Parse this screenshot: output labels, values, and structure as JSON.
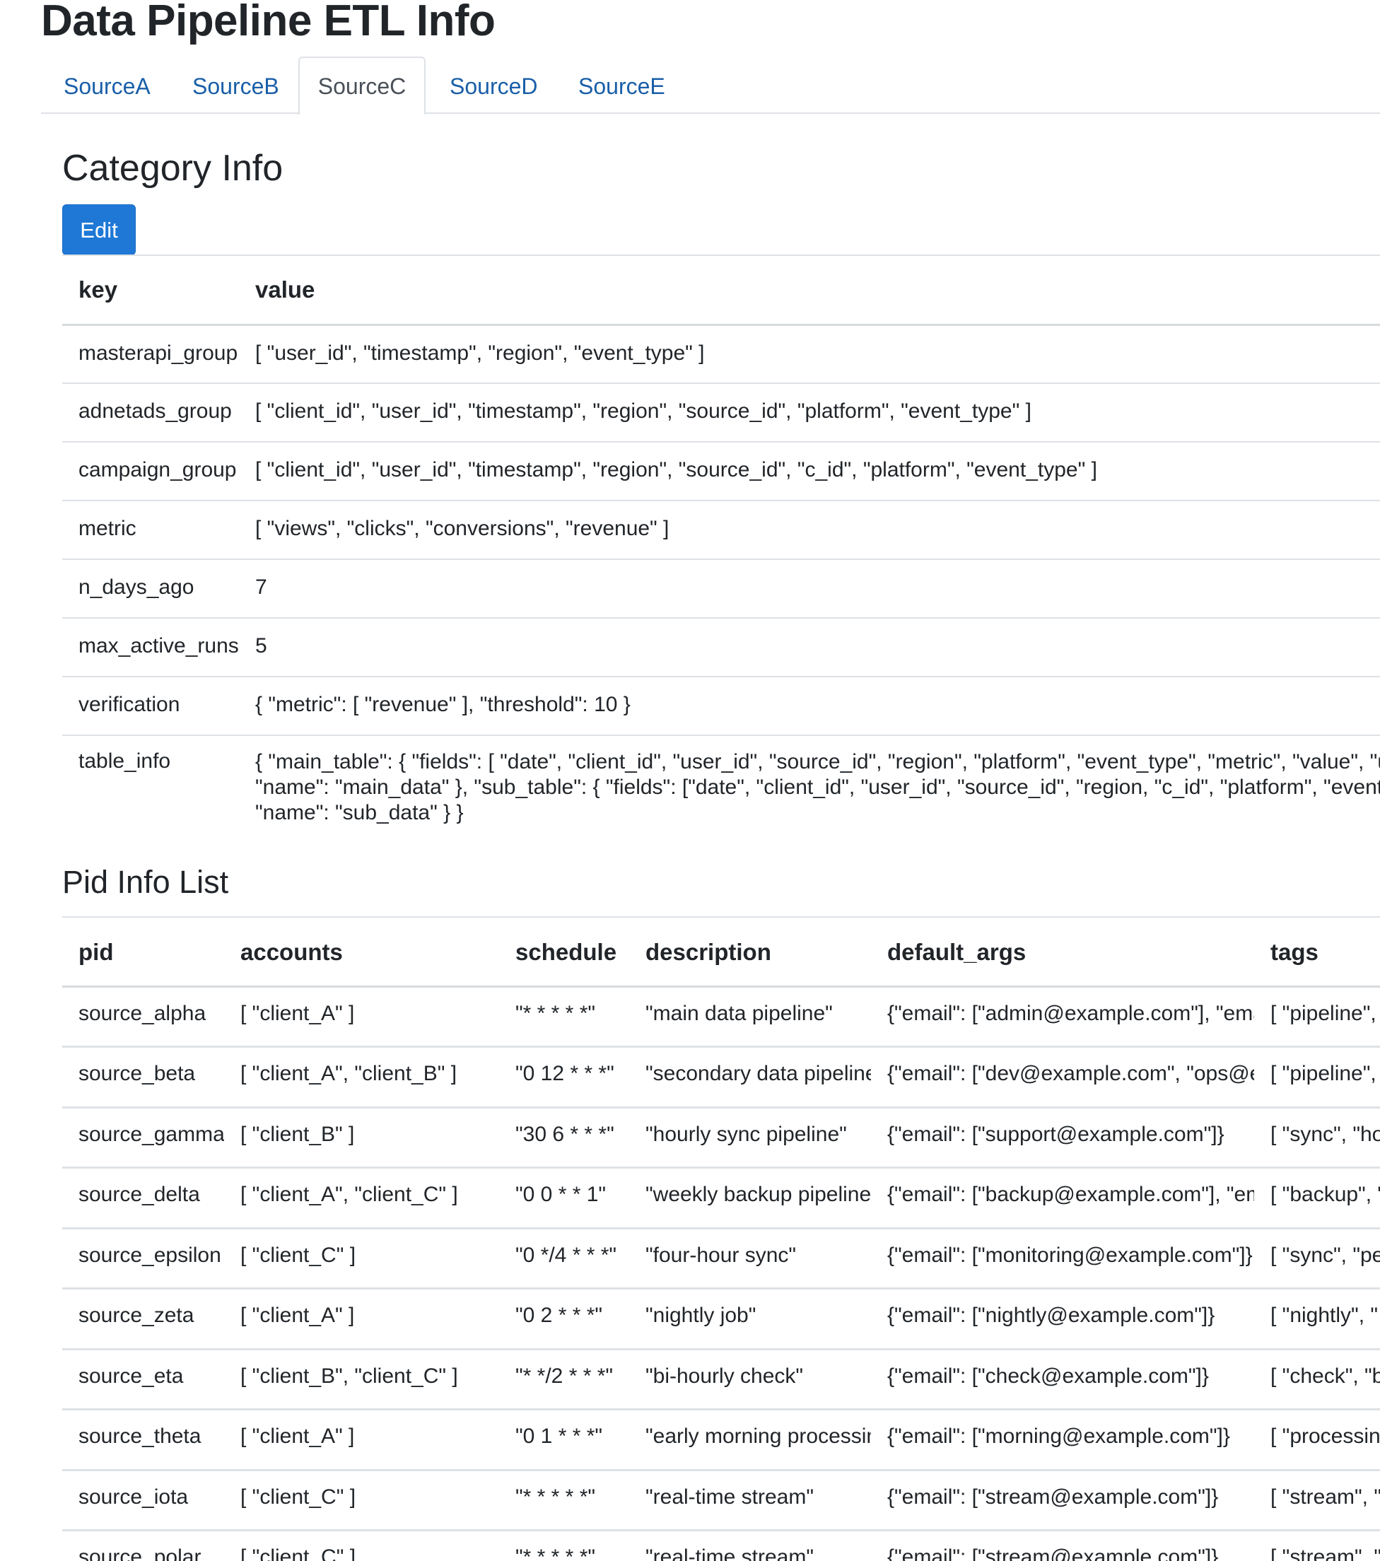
{
  "page": {
    "title": "Data Pipeline ETL Info"
  },
  "tabs": [
    {
      "label": "SourceA",
      "active": false
    },
    {
      "label": "SourceB",
      "active": false
    },
    {
      "label": "SourceC",
      "active": true
    },
    {
      "label": "SourceD",
      "active": false
    },
    {
      "label": "SourceE",
      "active": false
    }
  ],
  "category": {
    "title": "Category Info",
    "edit_label": "Edit",
    "columns": [
      "key",
      "value"
    ],
    "rows": [
      {
        "key": "masterapi_group",
        "value": "[ \"user_id\", \"timestamp\", \"region\", \"event_type\" ]"
      },
      {
        "key": "adnetads_group",
        "value": "[ \"client_id\", \"user_id\", \"timestamp\", \"region\", \"source_id\", \"platform\", \"event_type\" ]"
      },
      {
        "key": "campaign_group",
        "value": "[ \"client_id\", \"user_id\", \"timestamp\", \"region\", \"source_id\", \"c_id\", \"platform\", \"event_type\" ]"
      },
      {
        "key": "metric",
        "value": "[ \"views\", \"clicks\", \"conversions\", \"revenue\" ]"
      },
      {
        "key": "n_days_ago",
        "value": "7"
      },
      {
        "key": "max_active_runs",
        "value": "5"
      },
      {
        "key": "verification",
        "value": "{ \"metric\": [ \"revenue\" ], \"threshold\": 10 }"
      },
      {
        "key": "table_info",
        "value": "{ \"main_table\": { \"fields\": [ \"date\", \"client_id\", \"user_id\", \"source_id\", \"region\", \"platform\", \"event_type\", \"metric\", \"value\", \"update\n\"name\": \"main_data\" }, \"sub_table\": { \"fields\": [\"date\", \"client_id\", \"user_id\", \"source_id\", \"region, \"c_id\", \"platform\", \"event_type\"\n\"name\": \"sub_data\" } }"
      }
    ]
  },
  "pid": {
    "title": "Pid Info List",
    "columns": [
      "pid",
      "accounts",
      "schedule",
      "description",
      "default_args",
      "tags"
    ],
    "rows": [
      {
        "pid": "source_alpha",
        "accounts": "[ \"client_A\" ]",
        "schedule": "\"* * * * *\"",
        "description": "\"main data pipeline\"",
        "default_args": "{\"email\": [\"admin@example.com\"], \"email_o",
        "tags": "[ \"pipeline\", \""
      },
      {
        "pid": "source_beta",
        "accounts": "[ \"client_A\", \"client_B\" ]",
        "schedule": "\"0 12 * * *\"",
        "description": "\"secondary data pipeline\"",
        "default_args": "{\"email\": [\"dev@example.com\", \"ops@exam",
        "tags": "[ \"pipeline\", \""
      },
      {
        "pid": "source_gamma",
        "accounts": "[ \"client_B\" ]",
        "schedule": "\"30 6 * * *\"",
        "description": "\"hourly sync pipeline\"",
        "default_args": "{\"email\": [\"support@example.com\"]}",
        "tags": "[ \"sync\", \"ho"
      },
      {
        "pid": "source_delta",
        "accounts": "[ \"client_A\", \"client_C\" ]",
        "schedule": "\"0 0 * * 1\"",
        "description": "\"weekly backup pipeline\"",
        "default_args": "{\"email\": [\"backup@example.com\"], \"email_",
        "tags": "[ \"backup\", \""
      },
      {
        "pid": "source_epsilon",
        "accounts": "[ \"client_C\" ]",
        "schedule": "\"0 */4 * * *\"",
        "description": "\"four-hour sync\"",
        "default_args": "{\"email\": [\"monitoring@example.com\"]}",
        "tags": "[ \"sync\", \"pe"
      },
      {
        "pid": "source_zeta",
        "accounts": "[ \"client_A\" ]",
        "schedule": "\"0 2 * * *\"",
        "description": "\"nightly job\"",
        "default_args": "{\"email\": [\"nightly@example.com\"]}",
        "tags": "[ \"nightly\", \""
      },
      {
        "pid": "source_eta",
        "accounts": "[ \"client_B\", \"client_C\" ]",
        "schedule": "\"* */2 * * *\"",
        "description": "\"bi-hourly check\"",
        "default_args": "{\"email\": [\"check@example.com\"]}",
        "tags": "[ \"check\", \"b"
      },
      {
        "pid": "source_theta",
        "accounts": "[ \"client_A\" ]",
        "schedule": "\"0 1 * * *\"",
        "description": "\"early morning processing\"",
        "default_args": "{\"email\": [\"morning@example.com\"]}",
        "tags": "[ \"processing"
      },
      {
        "pid": "source_iota",
        "accounts": "[ \"client_C\" ]",
        "schedule": "\"* * * * *\"",
        "description": "\"real-time stream\"",
        "default_args": "{\"email\": [\"stream@example.com\"]}",
        "tags": "[ \"stream\", \""
      },
      {
        "pid": "source_polar",
        "accounts": "[ \"client_C\" ]",
        "schedule": "\"* * * * *\"",
        "description": "\"real-time stream\"",
        "default_args": "{\"email\": [\"stream@example.com\"]}",
        "tags": "[ \"stream\", \""
      }
    ]
  },
  "colors": {
    "link": "#1a5fa8",
    "primary_button": "#1f78d6",
    "border": "#dee2e6",
    "text": "#212529"
  }
}
